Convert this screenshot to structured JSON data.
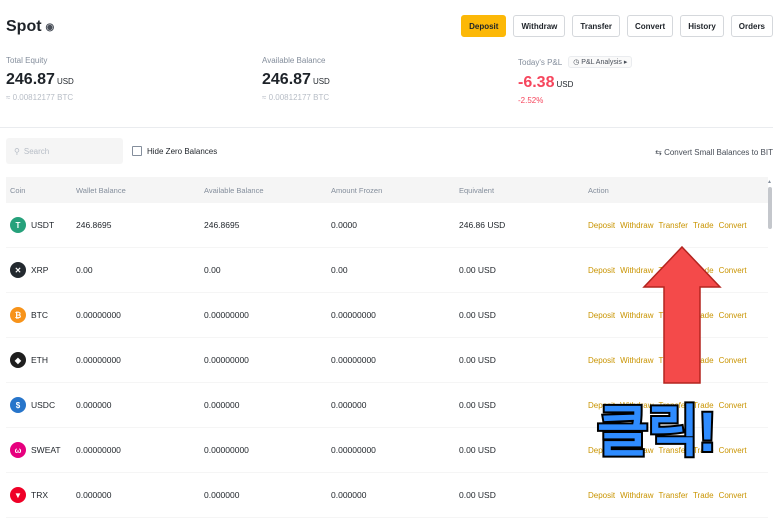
{
  "header": {
    "title": "Spot",
    "actions": [
      "Deposit",
      "Withdraw",
      "Transfer",
      "Convert",
      "History",
      "Orders"
    ]
  },
  "summary": {
    "total_equity": {
      "label": "Total Equity",
      "value": "246.87",
      "unit": "USD",
      "sub": "≈ 0.00812177 BTC"
    },
    "available_balance": {
      "label": "Available Balance",
      "value": "246.87",
      "unit": "USD",
      "sub": "≈ 0.00812177 BTC"
    },
    "pnl": {
      "label": "Today's P&L",
      "analysis": "P&L Analysis ▸",
      "value": "-6.38",
      "unit": "USD",
      "sub": "-2.52%"
    }
  },
  "toolbar": {
    "search_placeholder": "Search",
    "hide_zero": "Hide Zero Balances",
    "convert_small": "Convert Small Balances to BIT"
  },
  "table": {
    "headers": [
      "Coin",
      "Wallet Balance",
      "Available Balance",
      "Amount Frozen",
      "Equivalent",
      "Action"
    ],
    "actions": [
      "Deposit",
      "Withdraw",
      "Transfer",
      "Trade",
      "Convert"
    ],
    "rows": [
      {
        "coin": "USDT",
        "wallet": "246.8695",
        "available": "246.8695",
        "frozen": "0.0000",
        "equiv": "246.86 USD",
        "color": "#26a17b",
        "glyph": "T"
      },
      {
        "coin": "XRP",
        "wallet": "0.00",
        "available": "0.00",
        "frozen": "0.00",
        "equiv": "0.00 USD",
        "color": "#23292f",
        "glyph": "✕"
      },
      {
        "coin": "BTC",
        "wallet": "0.00000000",
        "available": "0.00000000",
        "frozen": "0.00000000",
        "equiv": "0.00 USD",
        "color": "#f7931a",
        "glyph": "₿"
      },
      {
        "coin": "ETH",
        "wallet": "0.00000000",
        "available": "0.00000000",
        "frozen": "0.00000000",
        "equiv": "0.00 USD",
        "color": "#1e1e1e",
        "glyph": "◆"
      },
      {
        "coin": "USDC",
        "wallet": "0.000000",
        "available": "0.000000",
        "frozen": "0.000000",
        "equiv": "0.00 USD",
        "color": "#2775ca",
        "glyph": "$"
      },
      {
        "coin": "SWEAT",
        "wallet": "0.00000000",
        "available": "0.00000000",
        "frozen": "0.00000000",
        "equiv": "0.00 USD",
        "color": "#e6007e",
        "glyph": "ω"
      },
      {
        "coin": "TRX",
        "wallet": "0.000000",
        "available": "0.000000",
        "frozen": "0.000000",
        "equiv": "0.00 USD",
        "color": "#ef0027",
        "glyph": "▼"
      }
    ]
  },
  "overlay": {
    "text": "클릭!",
    "arrow_color": "#f44a4a"
  }
}
